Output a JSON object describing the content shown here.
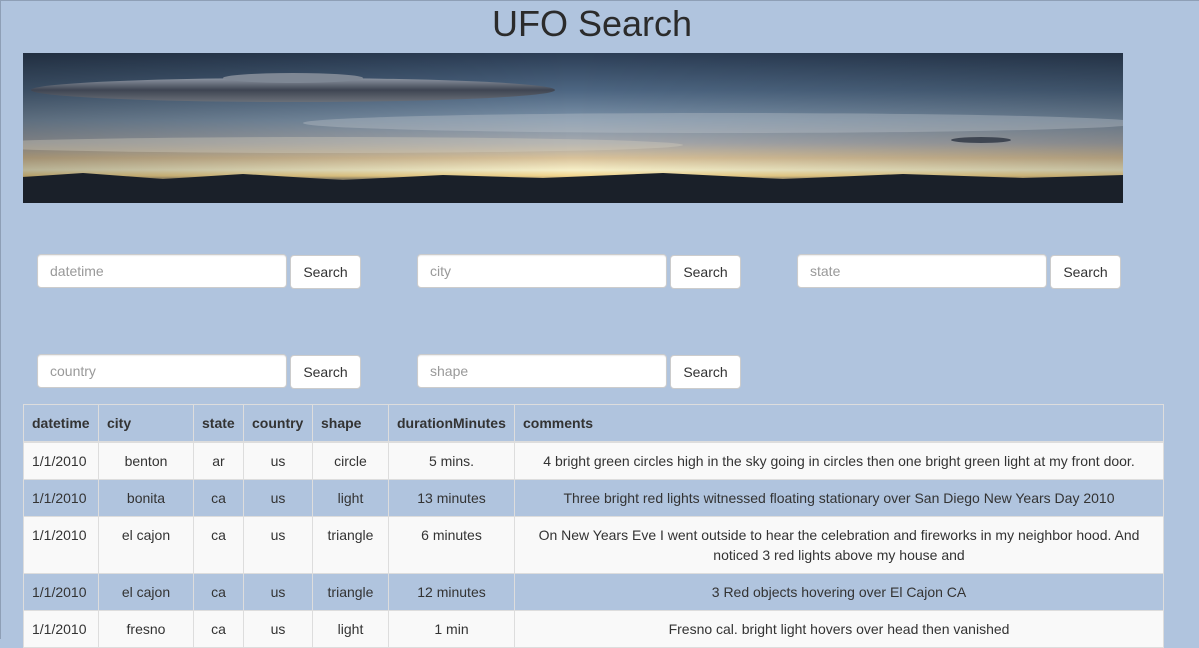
{
  "page": {
    "title": "UFO Search"
  },
  "filters": [
    {
      "name": "datetime",
      "placeholder": "datetime",
      "button_label": "Search"
    },
    {
      "name": "city",
      "placeholder": "city",
      "button_label": "Search"
    },
    {
      "name": "state",
      "placeholder": "state",
      "button_label": "Search"
    },
    {
      "name": "country",
      "placeholder": "country",
      "button_label": "Search"
    },
    {
      "name": "shape",
      "placeholder": "shape",
      "button_label": "Search"
    }
  ],
  "table": {
    "headers": [
      "datetime",
      "city",
      "state",
      "country",
      "shape",
      "durationMinutes",
      "comments"
    ],
    "rows": [
      [
        "1/1/2010",
        "benton",
        "ar",
        "us",
        "circle",
        "5 mins.",
        "4 bright green circles high in the sky going in circles then one bright green light at my front door."
      ],
      [
        "1/1/2010",
        "bonita",
        "ca",
        "us",
        "light",
        "13 minutes",
        "Three bright red lights witnessed floating stationary over San Diego New Years Day 2010"
      ],
      [
        "1/1/2010",
        "el cajon",
        "ca",
        "us",
        "triangle",
        "6 minutes",
        "On New Years Eve I went outside to hear the celebration and fireworks in my neighbor hood. And noticed 3 red lights above my house and"
      ],
      [
        "1/1/2010",
        "el cajon",
        "ca",
        "us",
        "triangle",
        "12 minutes",
        "3 Red objects hovering over El Cajon CA"
      ],
      [
        "1/1/2010",
        "fresno",
        "ca",
        "us",
        "light",
        "1 min",
        "Fresno cal. bright light hovers over head then vanished"
      ]
    ]
  }
}
